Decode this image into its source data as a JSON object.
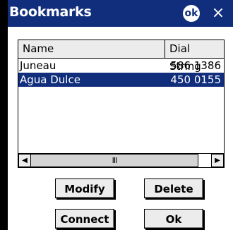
{
  "window": {
    "title": "Bookmarks",
    "ok_icon": "ok",
    "close": "×"
  },
  "list": {
    "columns": [
      "Name",
      "Dial String"
    ],
    "rows": [
      {
        "name": "Juneau",
        "dial": "586 1386",
        "selected": false
      },
      {
        "name": "Agua Dulce",
        "dial": "450 0155",
        "selected": true
      }
    ],
    "scroll_thumb": "III"
  },
  "buttons": {
    "modify": "Modify",
    "delete": "Delete",
    "connect": "Connect",
    "ok": "Ok"
  }
}
